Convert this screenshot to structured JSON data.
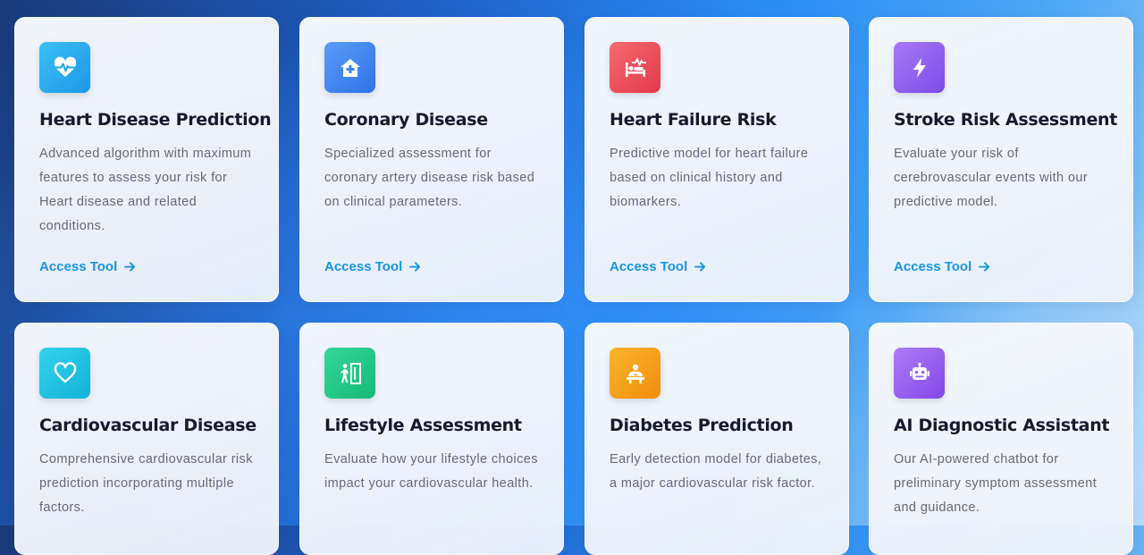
{
  "cards": [
    {
      "title": "Heart Disease Prediction",
      "description": "Advanced algorithm with maximum features to assess your risk for Heart disease and related conditions.",
      "icon": "heartbeat-icon",
      "color": "#29a9ee",
      "link_label": "Access Tool"
    },
    {
      "title": "Coronary Disease",
      "description": "Specialized assessment for coronary artery disease risk based on clinical parameters.",
      "icon": "clinic-medical-icon",
      "color": "#3f84ef",
      "link_label": "Access Tool"
    },
    {
      "title": "Heart Failure Risk",
      "description": "Predictive model for heart failure based on clinical history and biomarkers.",
      "icon": "hospital-bed-pulse-icon",
      "color": "#ef4d5c",
      "link_label": "Access Tool"
    },
    {
      "title": "Stroke Risk Assessment",
      "description": "Evaluate your risk of cerebrovascular events with our predictive model.",
      "icon": "lightning-bolt-icon",
      "color": "#9062f0",
      "link_label": "Access Tool"
    },
    {
      "title": "Cardiovascular Disease",
      "description": "Comprehensive cardiovascular risk prediction incorporating multiple factors.",
      "icon": "heart-outline-icon",
      "color": "#1fc3e3"
    },
    {
      "title": "Lifestyle Assessment",
      "description": "Evaluate how your lifestyle choices impact your cardiovascular health.",
      "icon": "person-walking-exit-icon",
      "color": "#24c98a"
    },
    {
      "title": "Diabetes Prediction",
      "description": "Early detection model for diabetes, a major cardiovascular risk factor.",
      "icon": "doctor-desk-icon",
      "color": "#f6a21a"
    },
    {
      "title": "AI Diagnostic Assistant",
      "description": "Our AI-powered chatbot for preliminary symptom assessment and guidance.",
      "icon": "robot-icon",
      "color": "#9a5ef0"
    }
  ]
}
